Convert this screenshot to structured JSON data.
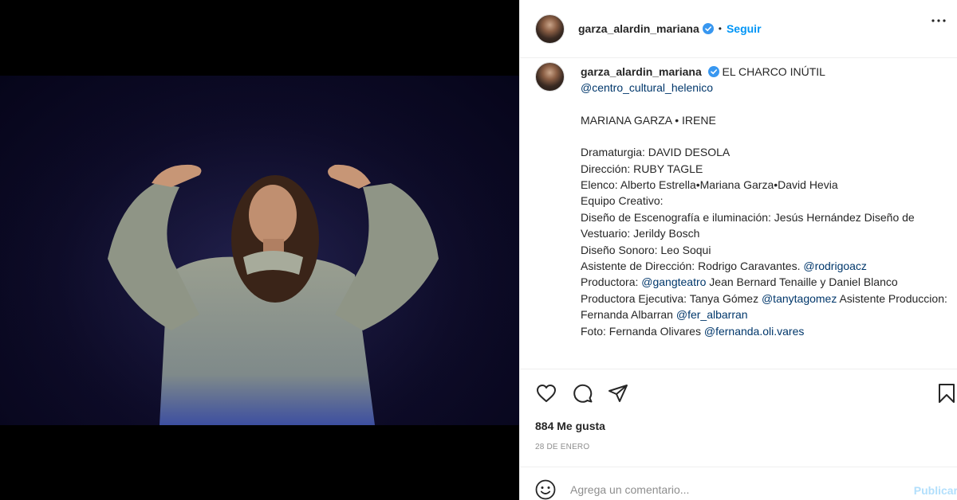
{
  "post": {
    "username": "garza_alardin_mariana",
    "follow_label": "Seguir",
    "separator": "•",
    "more_icon": "more-horizontal-icon",
    "caption": {
      "title": "EL CHARCO INÚTIL",
      "mention_venue": "@centro_cultural_helenico",
      "cast_line": "MARIANA GARZA • IRENE",
      "dramaturgia": "Dramaturgia: DAVID DESOLA",
      "direccion": "Dirección: RUBY TAGLE",
      "elenco": "Elenco: Alberto Estrella•Mariana Garza•David Hevia",
      "equipo": "Equipo Creativo:",
      "escenografia": "Diseño de Escenografía e iluminación: Jesús Hernández Diseño de Vestuario: Jerildy Bosch",
      "sonoro": "Diseño Sonoro: Leo Soqui",
      "asistente_text": "Asistente de Dirección: Rodrigo Caravantes. ",
      "asistente_mention": "@rodrigoacz",
      "productora_text": "Productora: ",
      "productora_mention": "@gangteatro",
      "productora_rest": " Jean Bernard Tenaille y Daniel Blanco",
      "ejecutiva_text": "Productora Ejecutiva: Tanya Gómez ",
      "ejecutiva_mention": "@tanytagomez",
      "ejecutiva_rest": " Asistente Produccion: Fernanda Albarran ",
      "ejecutiva_mention2": "@fer_albarran",
      "foto_text": "Foto: Fernanda Olivares ",
      "foto_mention": "@fernanda.oli.vares"
    },
    "likes": "884 Me gusta",
    "date": "28 DE ENERO",
    "comment_placeholder": "Agrega un comentario...",
    "publish_label": "Publicar",
    "icons": [
      "heart-icon",
      "comment-icon",
      "share-icon",
      "bookmark-icon",
      "emoji-icon",
      "verified-icon"
    ],
    "colors": {
      "link": "#00376b",
      "follow": "#0095f6",
      "publish_disabled": "#b2dffc",
      "verified": "#3897f0"
    }
  }
}
